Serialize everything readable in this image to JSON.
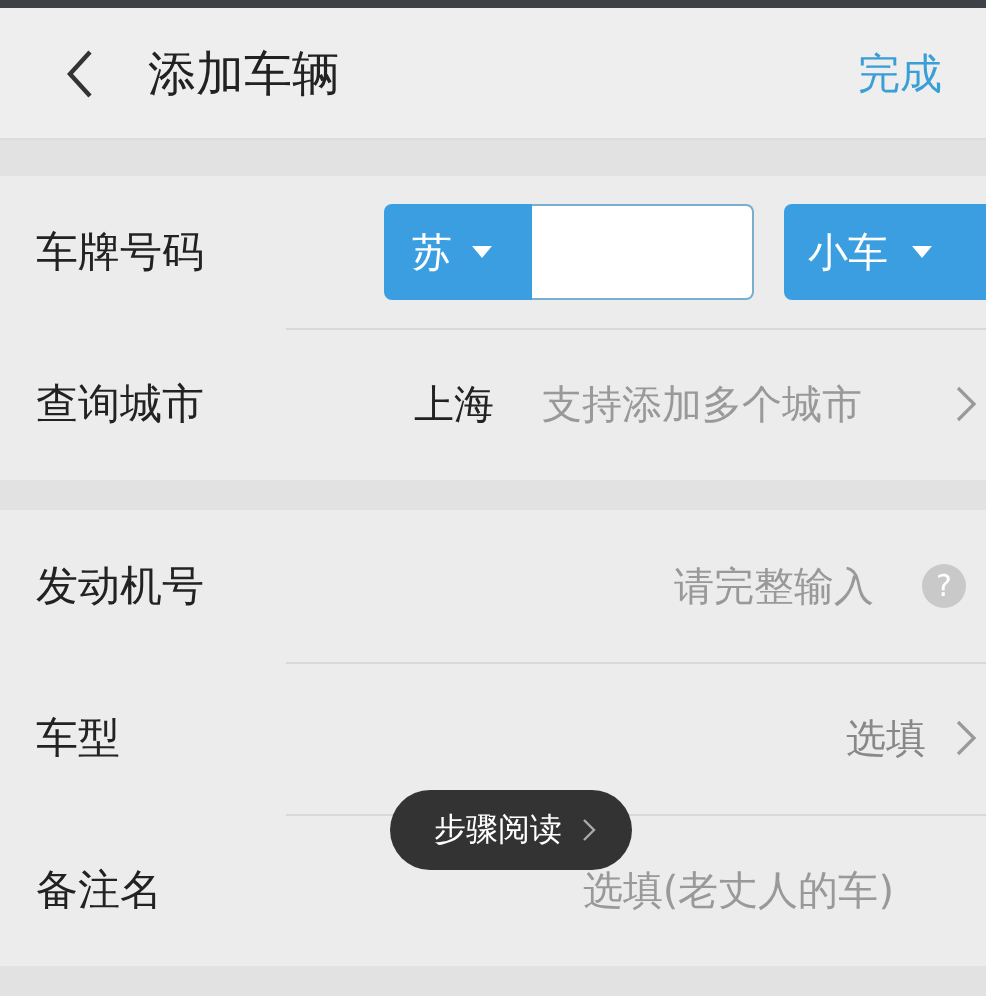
{
  "header": {
    "title": "添加车辆",
    "done": "完成"
  },
  "sections": [
    {
      "rows": [
        {
          "kind": "plate",
          "label": "车牌号码",
          "province": "苏",
          "vehicle_type": "小车"
        },
        {
          "kind": "city",
          "label": "查询城市",
          "value": "上海",
          "hint": "支持添加多个城市"
        }
      ]
    },
    {
      "rows": [
        {
          "kind": "input",
          "label": "发动机号",
          "placeholder": "请完整输入",
          "help": "?"
        },
        {
          "kind": "select",
          "label": "车型",
          "placeholder": "选填"
        },
        {
          "kind": "input",
          "label": "备注名",
          "placeholder": "选填(老丈人的车)"
        }
      ]
    }
  ],
  "toast": {
    "text": "步骤阅读"
  }
}
